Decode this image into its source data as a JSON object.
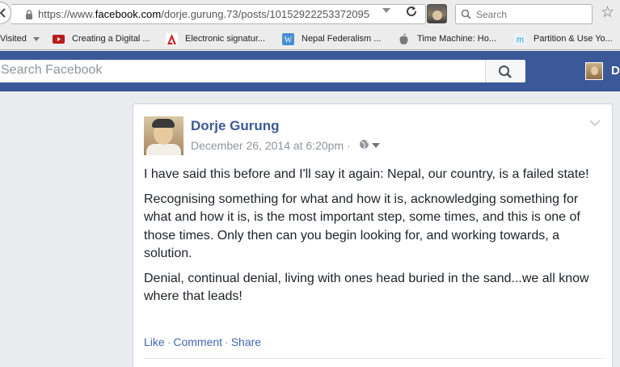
{
  "browser": {
    "url_prefix": "https://www.",
    "url_domain": "facebook.com",
    "url_path": "/dorje.gurung.73/posts/10152922253372095",
    "search_placeholder": "Search",
    "bookmarks": [
      {
        "label": "Visited",
        "icon": "most-visited"
      },
      {
        "label": "Creating a Digital ...",
        "icon": "youtube-icon",
        "color": "#b71c1c"
      },
      {
        "label": "Electronic signatur...",
        "icon": "adobe-icon",
        "color": "#cc2127"
      },
      {
        "label": "Nepal Federalism ...",
        "icon": "wordpress-icon",
        "color": "#4a8fd4"
      },
      {
        "label": "Time Machine: Ho...",
        "icon": "apple-icon",
        "color": "#7a7a7a"
      },
      {
        "label": "Partition & Use Yo...",
        "icon": "m-icon",
        "color": "#2a9fd8"
      }
    ]
  },
  "facebook": {
    "search_placeholder": "Search Facebook",
    "user_initial": "D",
    "brand_color": "#3b5998"
  },
  "post": {
    "author": "Dorje Gurung",
    "timestamp": "December 26, 2014 at 6:20pm",
    "separator": "·",
    "paragraphs": [
      "I have said this before and I'll say it again: Nepal, our country, is a failed state!",
      "Recognising something for what and how it is, acknowledging something for what and how it is, is the most important step, some times, and this is one of those times. Only then can you begin looking for, and working towards, a solution.",
      "Denial, continual denial, living with ones head buried in the sand...we all know where that leads!"
    ],
    "actions": {
      "like": "Like",
      "comment": "Comment",
      "share": "Share",
      "dot": "·"
    }
  }
}
